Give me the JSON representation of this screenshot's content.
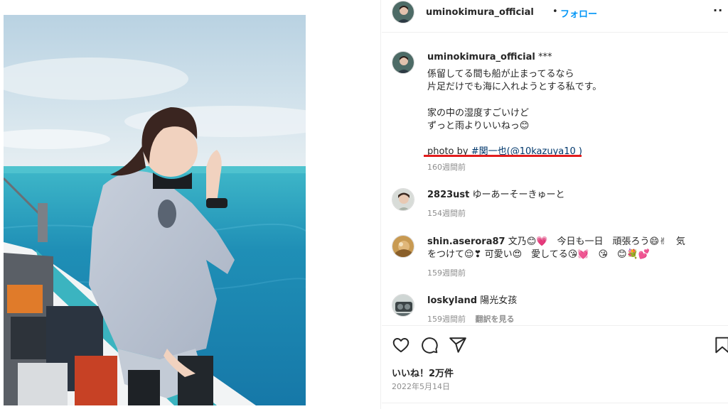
{
  "post": {
    "username": "uminokimura_official",
    "separator": "•",
    "follow_label": "フォロー",
    "more_label": "··",
    "caption": {
      "username": "uminokimura_official",
      "first_line": "***",
      "lines": [
        "係留してる間も船が止まってるなら",
        "片足だけでも海に入れようとする私です。",
        "家の中の湿度すごいけど",
        "ずっと雨よりいいねっ😊"
      ],
      "photo_by": "photo by",
      "hashtag": "#関一也",
      "mention_open": "(",
      "mention": "@10kazuya10",
      "mention_close": " )",
      "time": "160週間前"
    },
    "comments": [
      {
        "username": "2823ust",
        "text": "ゆーあーそーきゅーと",
        "time": "154週間前",
        "translate": ""
      },
      {
        "username": "shin.aserora87",
        "text": "文乃😊💗　今日も一日　頑張ろう😄✌　気",
        "text2": "をつけて😌❣ 可愛い😍　愛してる😘💓　😘　😊💐💕",
        "time": "159週間前",
        "translate": ""
      },
      {
        "username": "loskyland",
        "text": "陽光女孩",
        "time": "159週間前",
        "translate": "翻訳を見る"
      }
    ],
    "likes": "いいね！2万件",
    "date": "2022年5月14日",
    "icons": [
      "heart-icon",
      "comment-icon",
      "share-icon",
      "bookmark-icon"
    ],
    "colors": {
      "link": "#00376b",
      "follow": "#0095f6",
      "highlight": "#e21d1d",
      "muted": "#8e8e8e"
    }
  }
}
